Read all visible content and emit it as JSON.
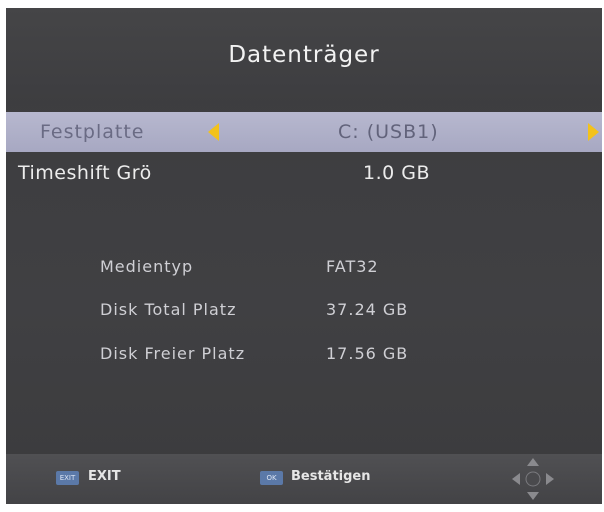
{
  "header": {
    "title": "Datenträger"
  },
  "settings": {
    "harddisk": {
      "label": "Festplatte",
      "value": "C: (USB1)"
    },
    "timeshift": {
      "label": "Timeshift Grö",
      "value": "1.0 GB"
    }
  },
  "disk_info": {
    "items": [
      {
        "label": "Medientyp",
        "value": "FAT32"
      },
      {
        "label": "Disk Total Platz",
        "value": "37.24 GB"
      },
      {
        "label": "Disk Freier Platz",
        "value": "17.56 GB"
      }
    ]
  },
  "footer": {
    "exit": {
      "key_label": "EXIT",
      "label": "EXIT"
    },
    "ok": {
      "key_label": "OK",
      "label": "Bestätigen"
    },
    "nav_icon": "directional-pad-icon"
  },
  "colors": {
    "background": "#3e3e41",
    "selection": "#b0b1ca",
    "arrow": "#f3c21b",
    "key": "#5b79a8"
  }
}
